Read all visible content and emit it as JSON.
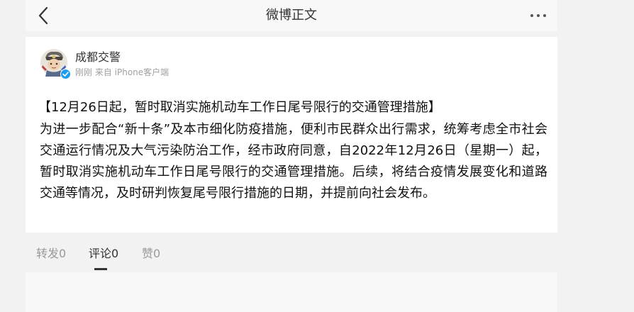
{
  "header": {
    "title": "微博正文",
    "back_icon": "chevron-left-icon",
    "more_icon": "more-dots-icon"
  },
  "post": {
    "author": "成都交警",
    "verified_icon": "verified-badge-icon",
    "time": "刚刚",
    "source": "来自 iPhone客户端",
    "title": "【12月26日起，暂时取消实施机动车工作日尾号限行的交通管理措施】",
    "body": "为进一步配合“新十条”及本市细化防疫措施，便利市民群众出行需求，统筹考虑全市社会交通运行情况及大气污染防治工作，经市政府同意，自2022年12月26日（星期一）起，暂时取消实施机动车工作日尾号限行的交通管理措施。后续，将结合疫情发展变化和道路交通等情况，及时研判恢复尾号限行措施的日期，并提前向社会发布。"
  },
  "tabs": [
    {
      "label": "转发",
      "count": "0"
    },
    {
      "label": "评论",
      "count": "0",
      "active": true
    },
    {
      "label": "赞",
      "count": "0"
    }
  ],
  "colors": {
    "page_bg": "#f2f2f2",
    "card_bg": "#ffffff",
    "text_primary": "#111111",
    "text_meta": "#a0a0a0",
    "verified_blue": "#1d9bf0"
  }
}
